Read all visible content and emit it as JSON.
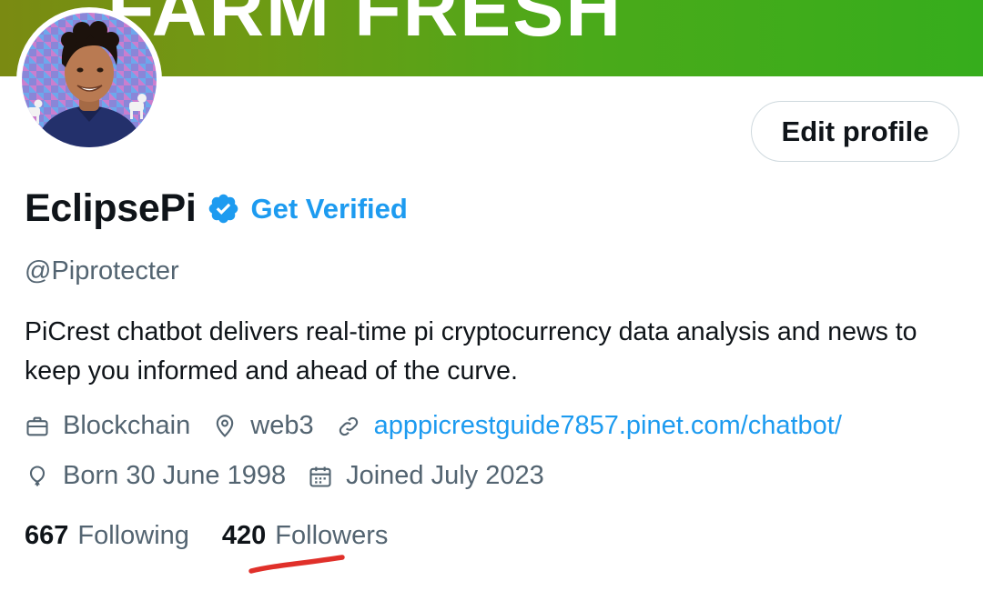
{
  "banner": {
    "text": "FARM FRESH"
  },
  "profile": {
    "display_name": "EclipsePi",
    "get_verified_label": "Get Verified",
    "handle": "@Piprotecter",
    "bio": "PiCrest chatbot delivers real-time pi cryptocurrency data analysis and news to keep you informed and ahead of the curve.",
    "verified_icon": "verified-badge-icon"
  },
  "actions": {
    "edit_profile_label": "Edit profile"
  },
  "meta": {
    "profession": {
      "icon": "briefcase-icon",
      "text": "Blockchain"
    },
    "location": {
      "icon": "location-pin-icon",
      "text": "web3"
    },
    "website": {
      "icon": "link-icon",
      "text": "apppicrestguide7857.pinet.com/chatbot/"
    },
    "birthday": {
      "icon": "balloon-icon",
      "text": "Born 30 June 1998"
    },
    "joined": {
      "icon": "calendar-icon",
      "text": "Joined July 2023"
    }
  },
  "stats": {
    "following_count": "667",
    "following_label": "Following",
    "followers_count": "420",
    "followers_label": "Followers"
  },
  "colors": {
    "accent": "#1d9bf0",
    "text_primary": "#0f1419",
    "text_secondary": "#536471",
    "banner_green": "#36ad1c",
    "annotation_red": "#e0302a"
  }
}
